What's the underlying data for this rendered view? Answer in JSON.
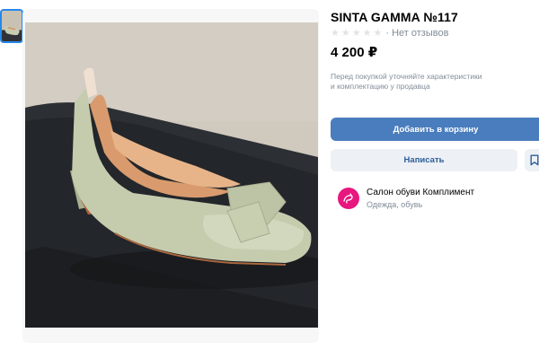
{
  "product": {
    "title": "SINTA GAMMA №117",
    "rating_stars": 0,
    "reviews": "· Нет отзывов",
    "price": "4 200 ₽",
    "note_line1": "Перед покупкой уточняйте характеристики",
    "note_line2": "и комплектацию у продавца"
  },
  "actions": {
    "add_to_cart": "Добавить в корзину",
    "write": "Написать"
  },
  "shop": {
    "name": "Салон обуви Комплимент",
    "category": "Одежда, обувь"
  },
  "colors": {
    "accent": "#4a7dbd",
    "secondary_button": "#edf0f5",
    "secondary_text": "#2d5f99",
    "muted_text": "#818c99",
    "avatar": "#e8167f"
  },
  "icons": {
    "star": "star-icon",
    "bookmark": "bookmark-icon",
    "shop_logo": "shop-logo-icon"
  }
}
